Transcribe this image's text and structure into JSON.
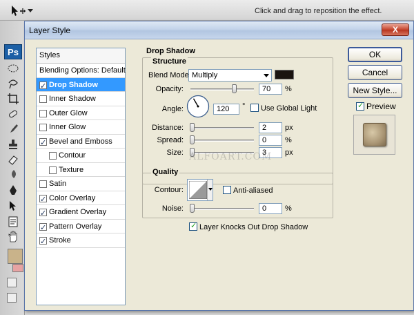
{
  "options_bar": {
    "hint": "Click and drag to reposition the effect."
  },
  "toolbar": {
    "logo": "Ps"
  },
  "dialog": {
    "title": "Layer Style",
    "close": "X",
    "styles_header": "Styles",
    "styles": [
      {
        "label": "Blending Options: Default",
        "has_checkbox": false,
        "checked": false,
        "indent": 0,
        "selected": false
      },
      {
        "label": "Drop Shadow",
        "has_checkbox": true,
        "checked": true,
        "indent": 0,
        "selected": true
      },
      {
        "label": "Inner Shadow",
        "has_checkbox": true,
        "checked": false,
        "indent": 0,
        "selected": false
      },
      {
        "label": "Outer Glow",
        "has_checkbox": true,
        "checked": false,
        "indent": 0,
        "selected": false
      },
      {
        "label": "Inner Glow",
        "has_checkbox": true,
        "checked": false,
        "indent": 0,
        "selected": false
      },
      {
        "label": "Bevel and Emboss",
        "has_checkbox": true,
        "checked": true,
        "indent": 0,
        "selected": false
      },
      {
        "label": "Contour",
        "has_checkbox": true,
        "checked": false,
        "indent": 1,
        "selected": false
      },
      {
        "label": "Texture",
        "has_checkbox": true,
        "checked": false,
        "indent": 1,
        "selected": false
      },
      {
        "label": "Satin",
        "has_checkbox": true,
        "checked": false,
        "indent": 0,
        "selected": false
      },
      {
        "label": "Color Overlay",
        "has_checkbox": true,
        "checked": true,
        "indent": 0,
        "selected": false
      },
      {
        "label": "Gradient Overlay",
        "has_checkbox": true,
        "checked": true,
        "indent": 0,
        "selected": false
      },
      {
        "label": "Pattern Overlay",
        "has_checkbox": true,
        "checked": true,
        "indent": 0,
        "selected": false
      },
      {
        "label": "Stroke",
        "has_checkbox": true,
        "checked": true,
        "indent": 0,
        "selected": false
      }
    ],
    "section_title": "Drop Shadow",
    "structure": {
      "title": "Structure",
      "blend_mode_label": "Blend Mode:",
      "blend_mode_value": "Multiply",
      "shadow_color": "#1a1410",
      "opacity_label": "Opacity:",
      "opacity_value": "70",
      "opacity_unit": "%",
      "opacity_fraction": 0.7,
      "angle_label": "Angle:",
      "angle_value": "120",
      "angle_unit": "°",
      "use_global_light_label": "Use Global Light",
      "use_global_light_checked": false,
      "distance_label": "Distance:",
      "distance_value": "2",
      "distance_unit": "px",
      "spread_label": "Spread:",
      "spread_value": "0",
      "spread_unit": "%",
      "size_label": "Size:",
      "size_value": "3",
      "size_unit": "px"
    },
    "quality": {
      "title": "Quality",
      "contour_label": "Contour:",
      "anti_aliased_label": "Anti-aliased",
      "anti_aliased_checked": false,
      "noise_label": "Noise:",
      "noise_value": "0",
      "noise_unit": "%"
    },
    "knockout_label": "Layer Knocks Out Drop Shadow",
    "knockout_checked": true,
    "buttons": {
      "ok": "OK",
      "cancel": "Cancel",
      "new_style": "New Style..."
    },
    "preview_label": "Preview",
    "preview_checked": true,
    "watermark": "ALFOART.COM"
  }
}
